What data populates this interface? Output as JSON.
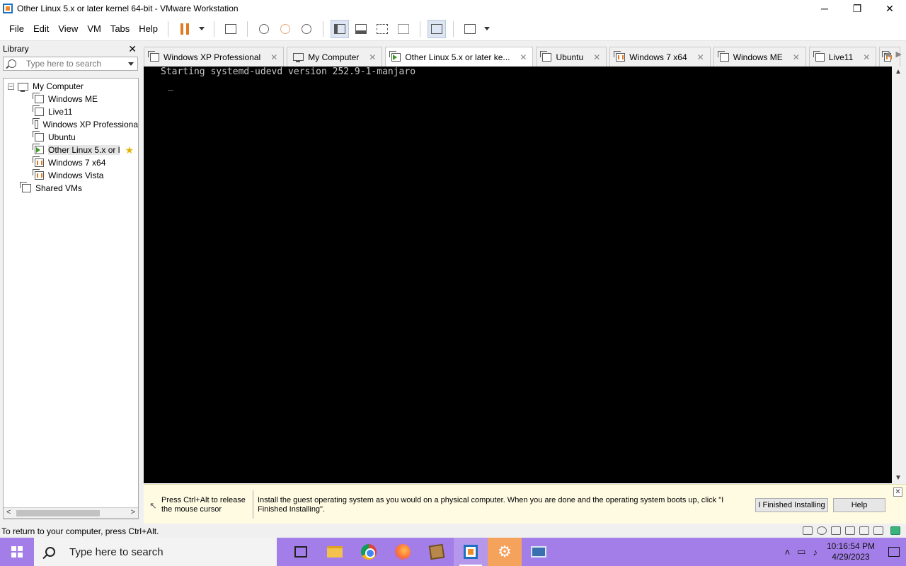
{
  "window": {
    "title": "Other Linux 5.x or later kernel 64-bit - VMware Workstation",
    "minimize": "─",
    "restore": "❐",
    "close": "✕"
  },
  "menu": {
    "items": [
      "File",
      "Edit",
      "View",
      "VM",
      "Tabs",
      "Help"
    ]
  },
  "toolbar": {
    "icons": [
      "pause-icon",
      "send-ctrl-alt-del-icon",
      "snapshot-icon",
      "revert-snapshot-icon",
      "snapshot-manager-icon",
      "show-library-icon",
      "thumbnail-bar-icon",
      "full-screen-icon",
      "unity-icon",
      "console-view-icon",
      "stretch-guest-icon"
    ]
  },
  "library": {
    "title": "Library",
    "close": "✕",
    "search_placeholder": "Type here to search",
    "root": "My Computer",
    "expander": "−",
    "items": [
      {
        "label": "Windows ME",
        "state": "off"
      },
      {
        "label": "Live11",
        "state": "off"
      },
      {
        "label": "Windows XP Professiona",
        "state": "off"
      },
      {
        "label": "Ubuntu",
        "state": "off"
      },
      {
        "label": "Other Linux 5.x or l",
        "state": "running"
      },
      {
        "label": "Windows 7 x64",
        "state": "paused"
      },
      {
        "label": "Windows Vista",
        "state": "paused"
      }
    ],
    "shared": "Shared VMs",
    "star": "★",
    "scroll_left": "<",
    "scroll_right": ">"
  },
  "tabs": [
    {
      "label": "Windows XP Professional",
      "close": "✕"
    },
    {
      "label": "My Computer",
      "close": "✕"
    },
    {
      "label": "Other Linux 5.x or later ke...",
      "close": "✕"
    },
    {
      "label": "Ubuntu",
      "close": "✕"
    },
    {
      "label": "Windows 7 x64",
      "close": "✕"
    },
    {
      "label": "Windows ME",
      "close": "✕"
    },
    {
      "label": "Live11",
      "close": "✕"
    }
  ],
  "tab_nav": {
    "prev": "◀",
    "next": "▶"
  },
  "console": {
    "line1": "Starting systemd-udevd version 252.9-1-manjaro",
    "cursor": "_"
  },
  "vscroll": {
    "up": "▲",
    "down": "▼"
  },
  "notification": {
    "release": "Press Ctrl+Alt to release the mouse cursor",
    "message": "Install the guest operating system as you would on a physical computer. When you are done and the operating system boots up, click \"I Finished Installing\".",
    "finish_button": "I Finished Installing",
    "help_button": "Help",
    "close": "✕",
    "mouse_icon": "↖"
  },
  "status": {
    "text": "To return to your computer, press Ctrl+Alt."
  },
  "taskbar": {
    "search_placeholder": "Type here to search",
    "time": "10:16:54 PM",
    "date": "4/29/2023",
    "tray_up": "˄",
    "gear": "⚙"
  }
}
